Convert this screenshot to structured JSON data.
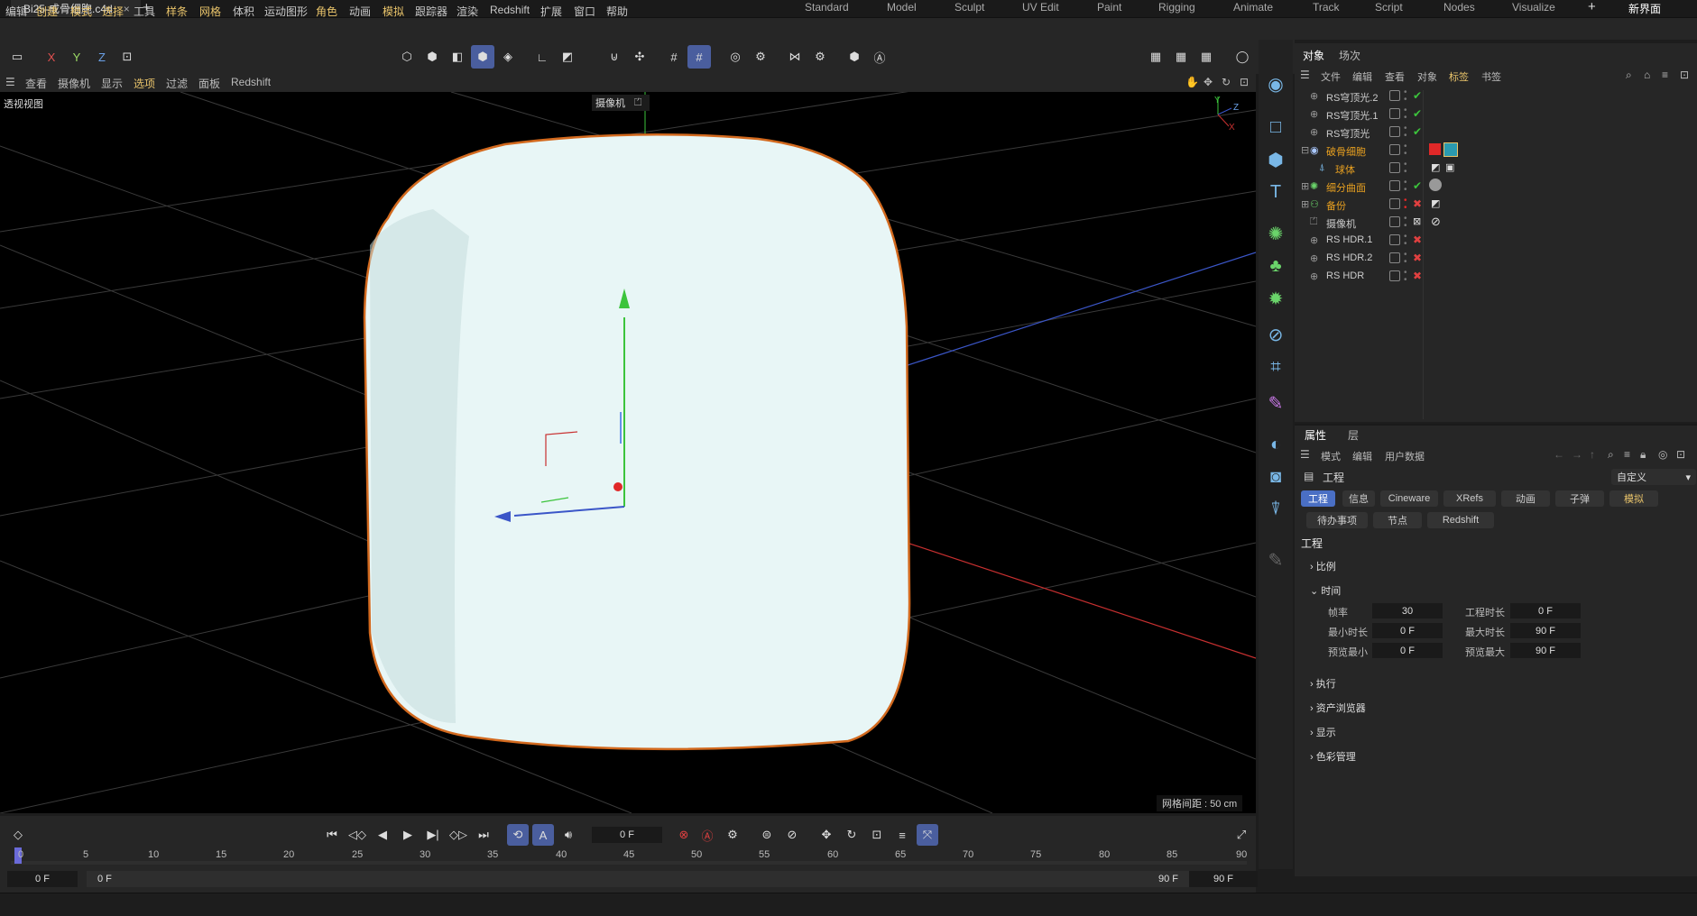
{
  "title_bar": {
    "file_tab": "Bi25-成骨细胞.c4d",
    "close_glyph": "×",
    "new_tab_glyph": "+",
    "layouts": [
      "Standard",
      "Model",
      "Sculpt",
      "UV Edit",
      "Paint",
      "Rigging",
      "Animate",
      "Track",
      "Script",
      "Nodes",
      "Visualize"
    ],
    "add_layout": "+",
    "new_ui": "新界面"
  },
  "menu": [
    "编辑",
    "创建",
    "模式",
    "选择",
    "工具",
    "样条",
    "网格",
    "体积",
    "运动图形",
    "角色",
    "动画",
    "模拟",
    "跟踪器",
    "渲染",
    "Redshift",
    "扩展",
    "窗口",
    "帮助"
  ],
  "toolbar": {
    "x": "X",
    "y": "Y",
    "z": "Z"
  },
  "viewport_menu": [
    "查看",
    "摄像机",
    "显示",
    "选项",
    "过滤",
    "面板",
    "Redshift"
  ],
  "viewport": {
    "label": "透视视图",
    "camera": "摄像机",
    "grid_spacing": "网格间距 : 50 cm",
    "axis_y": "Y",
    "axis_z": "Z",
    "axis_x": "X"
  },
  "object_panel": {
    "tabs": [
      "对象",
      "场次"
    ],
    "menu": [
      "文件",
      "编辑",
      "查看",
      "对象",
      "标签",
      "书签"
    ],
    "objects": [
      {
        "name": "RS穹顶光.2",
        "state": "check"
      },
      {
        "name": "RS穹顶光.1",
        "state": "check"
      },
      {
        "name": "RS穹顶光",
        "state": "check"
      },
      {
        "name": "破骨细胞",
        "state": "none",
        "highlight": true
      },
      {
        "name": "球体",
        "state": "none"
      },
      {
        "name": "细分曲面",
        "state": "check",
        "highlight": true
      },
      {
        "name": "备份",
        "state": "cross",
        "highlight": true
      },
      {
        "name": "摄像机",
        "state": "none"
      },
      {
        "name": "RS HDR.1",
        "state": "cross"
      },
      {
        "name": "RS HDR.2",
        "state": "cross"
      },
      {
        "name": "RS HDR",
        "state": "cross"
      }
    ]
  },
  "attributes": {
    "tabs": [
      "属性",
      "层"
    ],
    "menu": [
      "模式",
      "编辑",
      "用户数据"
    ],
    "object": "工程",
    "preset": "自定义",
    "buttons_row1": [
      "工程",
      "信息",
      "Cineware",
      "XRefs",
      "动画",
      "子弹",
      "模拟"
    ],
    "buttons_row2": [
      "待办事项",
      "节点",
      "Redshift"
    ],
    "heading": "工程",
    "sections": [
      "比例",
      "时间",
      "执行",
      "资产浏览器",
      "显示",
      "色彩管理"
    ],
    "time_fields": {
      "fps_label": "帧率",
      "fps": "30",
      "proj_len_label": "工程时长",
      "proj_len": "0 F",
      "min_label": "最小时长",
      "min": "0 F",
      "max_label": "最大时长",
      "max": "90 F",
      "prev_min_label": "预览最小",
      "prev_min": "0 F",
      "prev_max_label": "预览最大",
      "prev_max": "90 F"
    }
  },
  "timeline": {
    "current_frame": "0 F",
    "ticks": [
      "0",
      "5",
      "10",
      "15",
      "20",
      "25",
      "30",
      "35",
      "40",
      "45",
      "50",
      "55",
      "60",
      "65",
      "70",
      "75",
      "80",
      "85",
      "90"
    ],
    "start": "0 F",
    "range_start": "0 F",
    "range_end": "90 F",
    "end": "90 F"
  }
}
